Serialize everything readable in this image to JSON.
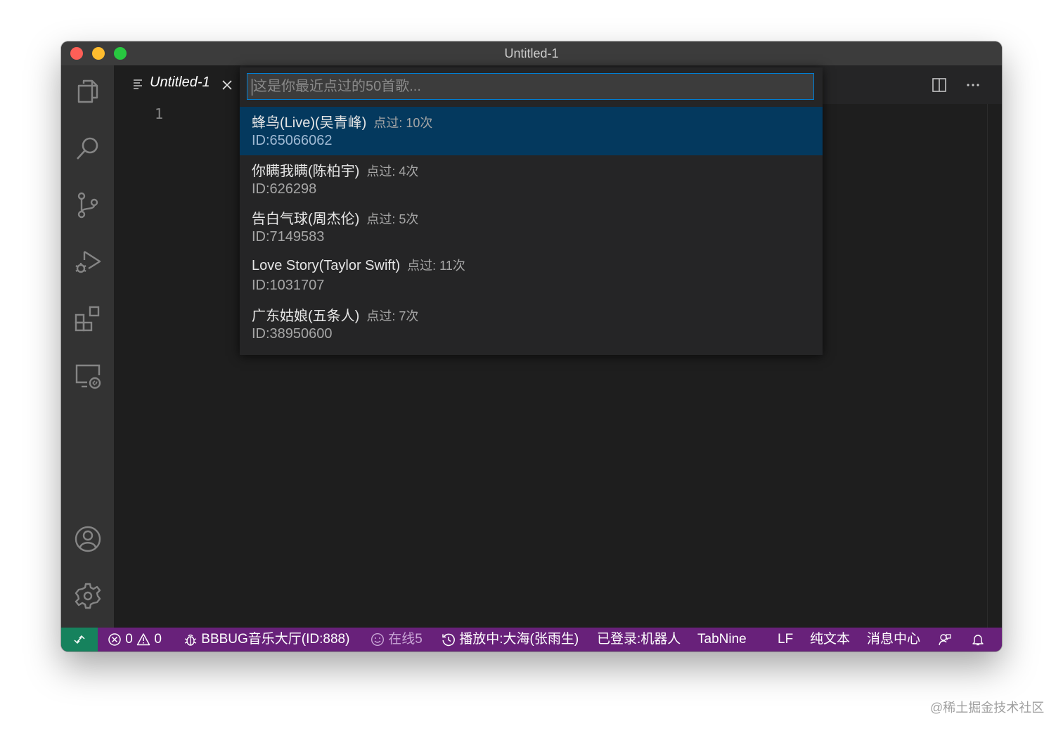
{
  "window": {
    "title": "Untitled-1"
  },
  "tab": {
    "label": "Untitled-1"
  },
  "editor": {
    "line_number": "1"
  },
  "quick_pick": {
    "placeholder": "这是你最近点过的50首歌...",
    "items": [
      {
        "title": "蜂鸟(Live)(吴青峰)",
        "description": "点过: 10次",
        "detail": "ID:65066062"
      },
      {
        "title": "你瞒我瞒(陈柏宇)",
        "description": "点过: 4次",
        "detail": "ID:626298"
      },
      {
        "title": "告白气球(周杰伦)",
        "description": "点过: 5次",
        "detail": "ID:7149583"
      },
      {
        "title": "Love Story(Taylor Swift)",
        "description": "点过: 11次",
        "detail": "ID:1031707"
      },
      {
        "title": "广东姑娘(五条人)",
        "description": "点过: 7次",
        "detail": "ID:38950600"
      }
    ]
  },
  "statusbar": {
    "errors": "0",
    "warnings": "0",
    "room": "BBBUG音乐大厅(ID:888)",
    "online": "在线5",
    "playing": "播放中:大海(张雨生)",
    "login": "已登录:机器人",
    "tabnine": "TabNine",
    "eol": "LF",
    "language": "纯文本",
    "messages": "消息中心"
  },
  "watermark": "@稀土掘金技术社区",
  "colors": {
    "statusbar": "#68217a",
    "remote": "#16825d",
    "selection": "#04395e",
    "focus_border": "#007fd4"
  },
  "icons": {
    "activity": [
      "files-icon",
      "search-icon",
      "source-control-icon",
      "run-debug-icon",
      "extensions-icon",
      "remote-explorer-icon",
      "account-icon",
      "settings-gear-icon"
    ],
    "status": [
      "remote-icon",
      "error-icon",
      "warning-icon",
      "bug-icon",
      "smiley-icon",
      "history-icon",
      "feedback-icon",
      "bell-icon"
    ]
  }
}
